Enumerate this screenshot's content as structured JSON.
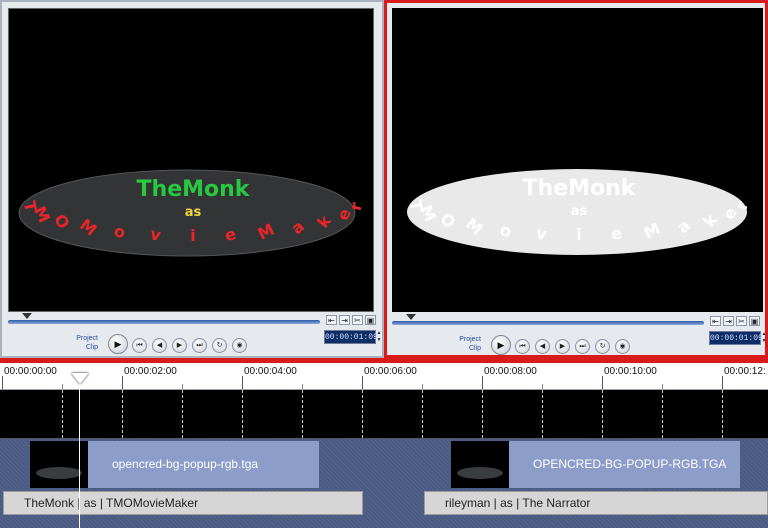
{
  "left_preview": {
    "title_text": "TheMonk",
    "as_text": "as",
    "arc_text": "TMOMovieMaker",
    "title_color": "#27c93f",
    "as_color": "#f2d641",
    "arc_color": "#e8262a",
    "ellipse_color": "#333436",
    "mode_project": "Project",
    "mode_clip": "Clip",
    "timecode": "00:00:01:09"
  },
  "right_preview": {
    "title_text": "TheMonk",
    "as_text": "as",
    "arc_text": "TMOMovieMaker",
    "title_color": "#ffffff",
    "ellipse_color": "#e9e9e9",
    "mode_project": "Project",
    "mode_clip": "Clip",
    "timecode": "00:00:01:09"
  },
  "ruler": {
    "ticks": [
      "00:00:00:00",
      "00:00:02:00",
      "00:00:04:00",
      "00:00:06:00",
      "00:00:08:00",
      "00:00:10:00",
      "00:00:12:"
    ]
  },
  "overlay_clips": [
    {
      "label": "opencred-bg-popup-rgb.tga"
    },
    {
      "label": "OPENCRED-BG-POPUP-RGB.TGA"
    }
  ],
  "title_clips": [
    {
      "label": "TheMonk | as | TMOMovieMaker"
    },
    {
      "label": "rileyman | as | The Narrator"
    }
  ],
  "icons": {
    "play": "play-icon",
    "home": "go-to-start-icon",
    "prev": "previous-frame-icon",
    "next": "next-frame-icon",
    "end": "go-to-end-icon",
    "repeat": "repeat-icon",
    "volume": "volume-icon"
  }
}
